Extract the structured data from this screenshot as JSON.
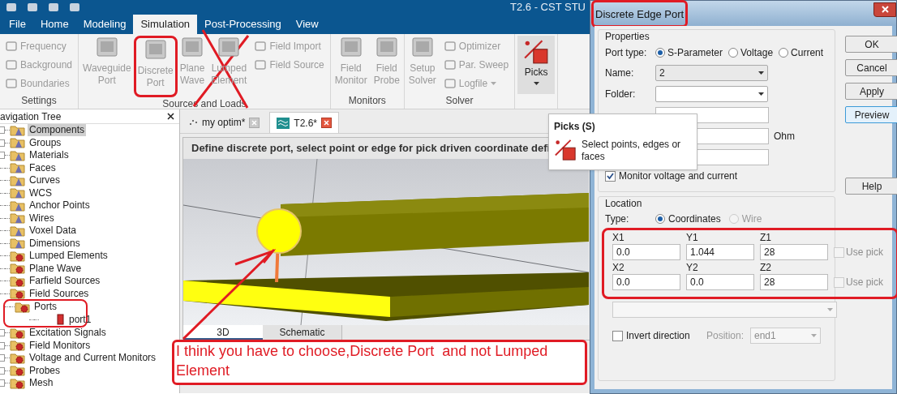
{
  "window": {
    "title": "T2.6 - CST STU"
  },
  "menu_tabs": [
    {
      "label": "File",
      "selected": false
    },
    {
      "label": "Home",
      "selected": false
    },
    {
      "label": "Modeling",
      "selected": false
    },
    {
      "label": "Simulation",
      "selected": true
    },
    {
      "label": "Post-Processing",
      "selected": false
    },
    {
      "label": "View",
      "selected": false
    }
  ],
  "ribbon": [
    {
      "label": "Settings",
      "items": [
        {
          "kind": "small",
          "label": "Frequency",
          "disabled": true
        },
        {
          "kind": "small",
          "label": "Background",
          "disabled": true
        },
        {
          "kind": "small",
          "label": "Boundaries",
          "disabled": true
        }
      ]
    },
    {
      "label": "Sources and Loads",
      "items": [
        {
          "kind": "large",
          "label": "Waveguide Port",
          "disabled": true
        },
        {
          "kind": "large",
          "label": "Discrete Port",
          "disabled": true,
          "circled": true
        },
        {
          "kind": "large",
          "label": "Plane Wave",
          "disabled": true
        },
        {
          "kind": "large",
          "label": "Lumped Element",
          "disabled": true
        },
        {
          "kind": "small",
          "label": "Field Import",
          "disabled": true
        },
        {
          "kind": "small",
          "label": "Field Source",
          "disabled": true
        }
      ]
    },
    {
      "label": "Monitors",
      "items": [
        {
          "kind": "large",
          "label": "Field Monitor",
          "disabled": true
        },
        {
          "kind": "large",
          "label": "Field Probe",
          "disabled": true
        }
      ]
    },
    {
      "label": "Solver",
      "items": [
        {
          "kind": "large",
          "label": "Setup Solver",
          "disabled": true
        },
        {
          "kind": "small",
          "label": "Optimizer",
          "disabled": true
        },
        {
          "kind": "small",
          "label": "Par. Sweep",
          "disabled": true
        },
        {
          "kind": "small",
          "label": "Logfile",
          "disabled": true,
          "dropdown": true
        }
      ]
    },
    {
      "items": [
        {
          "kind": "picks",
          "label": "Picks",
          "disabled": false,
          "dropdown": true
        }
      ]
    }
  ],
  "navigation_tree": {
    "title": "avigation Tree",
    "items": [
      {
        "label": "Components",
        "kind": "geometry",
        "expandable": true,
        "selected": true
      },
      {
        "label": "Groups",
        "kind": "geometry",
        "expandable": true,
        "selected": false
      },
      {
        "label": "Materials",
        "kind": "geometry",
        "expandable": true,
        "selected": false
      },
      {
        "label": "Faces",
        "kind": "geometry",
        "expandable": false,
        "selected": false
      },
      {
        "label": "Curves",
        "kind": "geometry",
        "expandable": false,
        "selected": false
      },
      {
        "label": "WCS",
        "kind": "geometry",
        "expandable": false,
        "selected": false
      },
      {
        "label": "Anchor Points",
        "kind": "geometry",
        "expandable": false,
        "selected": false
      },
      {
        "label": "Wires",
        "kind": "geometry",
        "expandable": false,
        "selected": false
      },
      {
        "label": "Voxel Data",
        "kind": "geometry",
        "expandable": false,
        "selected": false
      },
      {
        "label": "Dimensions",
        "kind": "geometry",
        "expandable": false,
        "selected": false
      },
      {
        "label": "Lumped Elements",
        "kind": "source",
        "expandable": false,
        "selected": false
      },
      {
        "label": "Plane Wave",
        "kind": "source",
        "expandable": false,
        "selected": false
      },
      {
        "label": "Farfield Sources",
        "kind": "source",
        "expandable": false,
        "selected": false
      },
      {
        "label": "Field Sources",
        "kind": "source",
        "expandable": false,
        "selected": false
      },
      {
        "label": "Ports",
        "kind": "source",
        "expandable": false,
        "selected": false,
        "circled": true,
        "children": [
          {
            "label": "port1",
            "kind": "port",
            "expandable": false,
            "selected": false
          }
        ]
      },
      {
        "label": "Excitation Signals",
        "kind": "source",
        "expandable": true,
        "selected": false
      },
      {
        "label": "Field Monitors",
        "kind": "source",
        "expandable": true,
        "selected": false
      },
      {
        "label": "Voltage and Current Monitors",
        "kind": "source",
        "expandable": true,
        "selected": false
      },
      {
        "label": "Probes",
        "kind": "source",
        "expandable": true,
        "selected": false
      },
      {
        "label": "Mesh",
        "kind": "source",
        "expandable": true,
        "selected": false
      }
    ]
  },
  "document_tabs": [
    {
      "label": "my optim*",
      "selected": false
    },
    {
      "label": "T2.6*",
      "selected": true
    }
  ],
  "viewport": {
    "hint": "Define discrete port, select point or edge for pick driven coordinate defi",
    "view_tabs": [
      {
        "label": "3D",
        "selected": true
      },
      {
        "label": "Schematic",
        "selected": false
      }
    ]
  },
  "tooltip": {
    "title": "Picks (S)",
    "text": "Select points, edges or faces"
  },
  "dialog": {
    "title": "Discrete Edge Port",
    "title_circled": true,
    "properties": {
      "label": "Properties",
      "rows": [
        {
          "kind": "radio",
          "label": "Port type:",
          "options": [
            {
              "label": "S-Parameter",
              "selected": true,
              "disabled": false
            },
            {
              "label": "Voltage",
              "selected": false,
              "disabled": false
            },
            {
              "label": "Current",
              "selected": false,
              "disabled": false
            }
          ]
        },
        {
          "kind": "dropdown",
          "label": "Name:",
          "value": "2"
        },
        {
          "kind": "dropdown",
          "label": "Folder:"
        },
        {
          "kind": "text"
        },
        {
          "kind": "text",
          "unit": "Ohm"
        },
        {
          "kind": "text"
        },
        {
          "kind": "checkbox",
          "label": "Monitor voltage and current",
          "checked": true,
          "disabled": false
        }
      ]
    },
    "buttons": [
      {
        "label": "OK",
        "focused": false
      },
      {
        "label": "Cancel",
        "focused": false
      },
      {
        "label": "Apply",
        "focused": false
      },
      {
        "label": "Preview",
        "focused": true
      },
      {
        "label": "Help",
        "focused": false
      }
    ],
    "location": {
      "label": "Location",
      "type_label": "Type:",
      "types": [
        {
          "label": "Coordinates",
          "selected": true,
          "disabled": false
        },
        {
          "label": "Wire",
          "selected": false,
          "disabled": true
        }
      ],
      "points_circled": true,
      "points": [
        {
          "fields": [
            {
              "label": "X1",
              "value": "0.0"
            },
            {
              "label": "Y1",
              "value": "1.044"
            },
            {
              "label": "Z1",
              "value": "28"
            }
          ],
          "use_pick": {
            "label": "Use pick",
            "checked": false,
            "disabled": true
          }
        },
        {
          "fields": [
            {
              "label": "X2",
              "value": "0.0"
            },
            {
              "label": "Y2",
              "value": "0.0"
            },
            {
              "label": "Z2",
              "value": "28"
            }
          ],
          "use_pick": {
            "label": "Use pick",
            "checked": false,
            "disabled": true
          }
        }
      ],
      "invert": {
        "label": "Invert direction",
        "checked": false,
        "disabled": false
      },
      "position": {
        "label": "Position:",
        "value": "end1",
        "disabled": true
      }
    }
  },
  "annotation": {
    "text": "I think you have to choose,Discrete Port  and not Lumped Element"
  }
}
